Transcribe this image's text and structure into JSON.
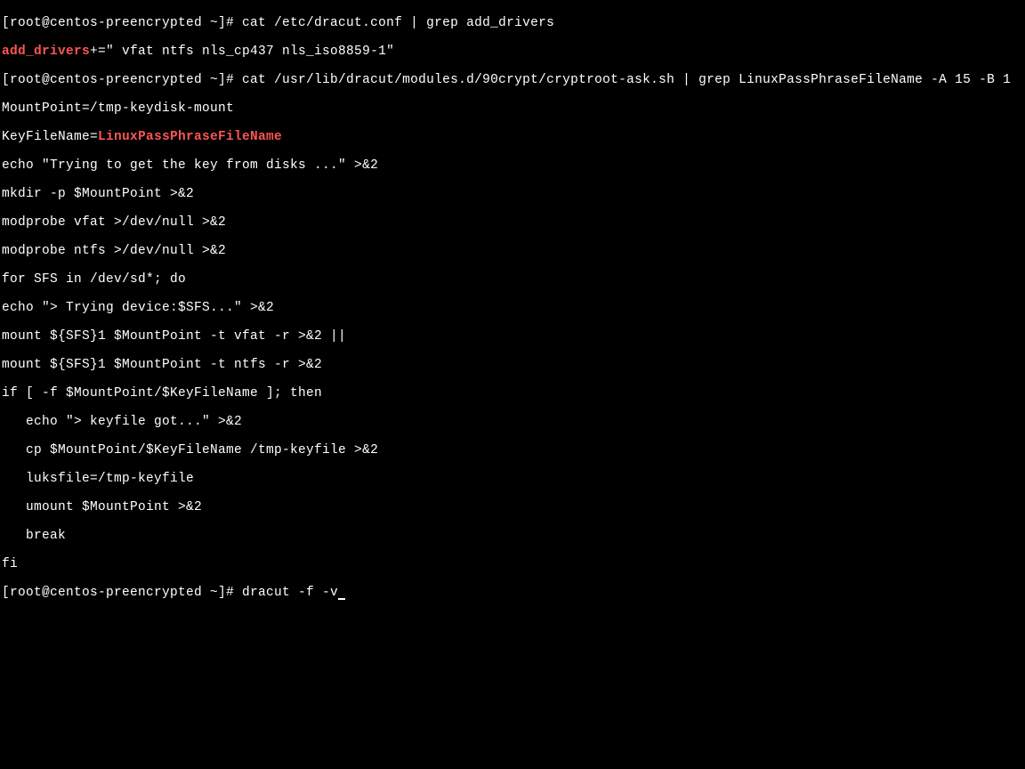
{
  "prompt1": "[root@centos-preencrypted ~]# cat /etc/dracut.conf | grep add_drivers",
  "line2a": "add_drivers",
  "line2b": "+=\" vfat ntfs nls_cp437 nls_iso8859-1\"",
  "prompt2": "[root@centos-preencrypted ~]# cat /usr/lib/dracut/modules.d/90crypt/cryptroot-ask.sh | grep LinuxPassPhraseFileName -A 15 -B 1",
  "line4": "MountPoint=/tmp-keydisk-mount",
  "line5a": "KeyFileName=",
  "line5b": "LinuxPassPhraseFileName",
  "line6": "echo \"Trying to get the key from disks ...\" >&2",
  "line7": "mkdir -p $MountPoint >&2",
  "line8": "modprobe vfat >/dev/null >&2",
  "line9": "modprobe ntfs >/dev/null >&2",
  "line10": "for SFS in /dev/sd*; do",
  "line11": "echo \"> Trying device:$SFS...\" >&2",
  "line12": "mount ${SFS}1 $MountPoint -t vfat -r >&2 ||",
  "line13": "mount ${SFS}1 $MountPoint -t ntfs -r >&2",
  "line14": "if [ -f $MountPoint/$KeyFileName ]; then",
  "line15": "   echo \"> keyfile got...\" >&2",
  "line16": "   cp $MountPoint/$KeyFileName /tmp-keyfile >&2",
  "line17": "   luksfile=/tmp-keyfile",
  "line18": "   umount $MountPoint >&2",
  "line19": "   break",
  "line20": "fi",
  "prompt3": "[root@centos-preencrypted ~]# dracut -f -v"
}
